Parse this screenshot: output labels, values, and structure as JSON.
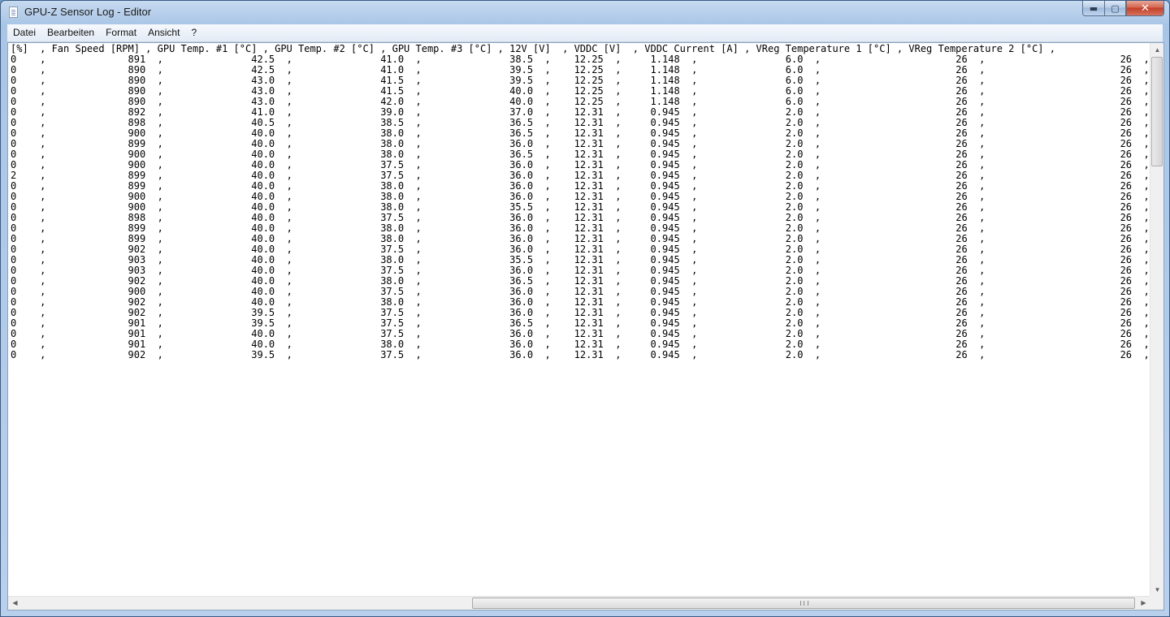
{
  "window": {
    "title": "GPU-Z Sensor Log - Editor",
    "min_glyph": "▬",
    "max_glyph": "▢",
    "close_glyph": "✕"
  },
  "menu": [
    "Datei",
    "Bearbeiten",
    "Format",
    "Ansicht",
    "?"
  ],
  "log": {
    "header": "[%]  , Fan Speed [RPM] , GPU Temp. #1 [°C] , GPU Temp. #2 [°C] , GPU Temp. #3 [°C] , 12V [V]  , VDDC [V]  , VDDC Current [A] , VReg Temperature 1 [°C] , VReg Temperature 2 [°C] ,",
    "rows": [
      [
        "0",
        "891",
        "42.5",
        "41.0",
        "38.5",
        "12.25",
        "1.148",
        "6.0",
        "26",
        "26"
      ],
      [
        "0",
        "890",
        "42.5",
        "41.0",
        "39.5",
        "12.25",
        "1.148",
        "6.0",
        "26",
        "26"
      ],
      [
        "0",
        "890",
        "43.0",
        "41.5",
        "39.5",
        "12.25",
        "1.148",
        "6.0",
        "26",
        "26"
      ],
      [
        "0",
        "890",
        "43.0",
        "41.5",
        "40.0",
        "12.25",
        "1.148",
        "6.0",
        "26",
        "26"
      ],
      [
        "0",
        "890",
        "43.0",
        "42.0",
        "40.0",
        "12.25",
        "1.148",
        "6.0",
        "26",
        "26"
      ],
      [
        "0",
        "892",
        "41.0",
        "39.0",
        "37.0",
        "12.31",
        "0.945",
        "2.0",
        "26",
        "26"
      ],
      [
        "0",
        "898",
        "40.5",
        "38.5",
        "36.5",
        "12.31",
        "0.945",
        "2.0",
        "26",
        "26"
      ],
      [
        "0",
        "900",
        "40.0",
        "38.0",
        "36.5",
        "12.31",
        "0.945",
        "2.0",
        "26",
        "26"
      ],
      [
        "0",
        "899",
        "40.0",
        "38.0",
        "36.0",
        "12.31",
        "0.945",
        "2.0",
        "26",
        "26"
      ],
      [
        "0",
        "900",
        "40.0",
        "38.0",
        "36.5",
        "12.31",
        "0.945",
        "2.0",
        "26",
        "26"
      ],
      [
        "0",
        "900",
        "40.0",
        "37.5",
        "36.0",
        "12.31",
        "0.945",
        "2.0",
        "26",
        "26"
      ],
      [
        "2",
        "899",
        "40.0",
        "37.5",
        "36.0",
        "12.31",
        "0.945",
        "2.0",
        "26",
        "26"
      ],
      [
        "0",
        "899",
        "40.0",
        "38.0",
        "36.0",
        "12.31",
        "0.945",
        "2.0",
        "26",
        "26"
      ],
      [
        "0",
        "900",
        "40.0",
        "38.0",
        "36.0",
        "12.31",
        "0.945",
        "2.0",
        "26",
        "26"
      ],
      [
        "0",
        "900",
        "40.0",
        "38.0",
        "35.5",
        "12.31",
        "0.945",
        "2.0",
        "26",
        "26"
      ],
      [
        "0",
        "898",
        "40.0",
        "37.5",
        "36.0",
        "12.31",
        "0.945",
        "2.0",
        "26",
        "26"
      ],
      [
        "0",
        "899",
        "40.0",
        "38.0",
        "36.0",
        "12.31",
        "0.945",
        "2.0",
        "26",
        "26"
      ],
      [
        "0",
        "899",
        "40.0",
        "38.0",
        "36.0",
        "12.31",
        "0.945",
        "2.0",
        "26",
        "26"
      ],
      [
        "0",
        "902",
        "40.0",
        "37.5",
        "36.0",
        "12.31",
        "0.945",
        "2.0",
        "26",
        "26"
      ],
      [
        "0",
        "903",
        "40.0",
        "38.0",
        "35.5",
        "12.31",
        "0.945",
        "2.0",
        "26",
        "26"
      ],
      [
        "0",
        "903",
        "40.0",
        "37.5",
        "36.0",
        "12.31",
        "0.945",
        "2.0",
        "26",
        "26"
      ],
      [
        "0",
        "902",
        "40.0",
        "38.0",
        "36.5",
        "12.31",
        "0.945",
        "2.0",
        "26",
        "26"
      ],
      [
        "0",
        "900",
        "40.0",
        "37.5",
        "36.0",
        "12.31",
        "0.945",
        "2.0",
        "26",
        "26"
      ],
      [
        "0",
        "902",
        "40.0",
        "38.0",
        "36.0",
        "12.31",
        "0.945",
        "2.0",
        "26",
        "26"
      ],
      [
        "0",
        "902",
        "39.5",
        "37.5",
        "36.0",
        "12.31",
        "0.945",
        "2.0",
        "26",
        "26"
      ],
      [
        "0",
        "901",
        "39.5",
        "37.5",
        "36.5",
        "12.31",
        "0.945",
        "2.0",
        "26",
        "26"
      ],
      [
        "0",
        "901",
        "40.0",
        "37.5",
        "36.0",
        "12.31",
        "0.945",
        "2.0",
        "26",
        "26"
      ],
      [
        "0",
        "901",
        "40.0",
        "38.0",
        "36.0",
        "12.31",
        "0.945",
        "2.0",
        "26",
        "26"
      ],
      [
        "0",
        "902",
        "39.5",
        "37.5",
        "36.0",
        "12.31",
        "0.945",
        "2.0",
        "26",
        "26"
      ]
    ]
  },
  "scrollbars": {
    "up_glyph": "▲",
    "down_glyph": "▼",
    "left_glyph": "◀",
    "right_glyph": "▶"
  }
}
